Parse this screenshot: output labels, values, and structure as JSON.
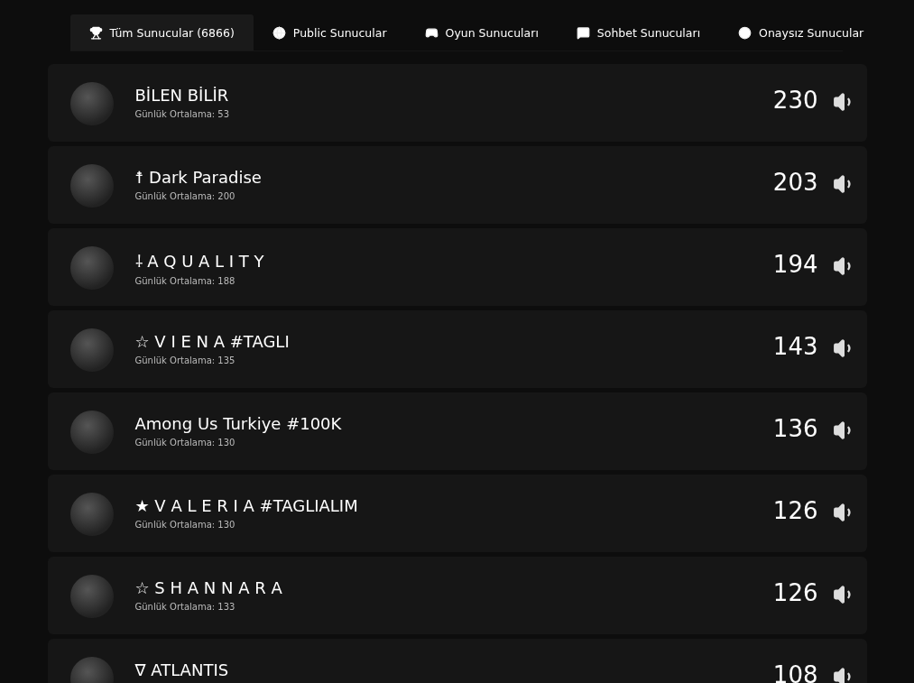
{
  "tabs": [
    {
      "label": "Tüm Sunucular (6866)",
      "selected": true
    },
    {
      "label": "Public Sunucular",
      "selected": false
    },
    {
      "label": "Oyun Sunucuları",
      "selected": false
    },
    {
      "label": "Sohbet Sunucuları",
      "selected": false
    },
    {
      "label": "Onaysız Sunucular",
      "selected": false
    }
  ],
  "servers": [
    {
      "name": "BİLEN BİLİR",
      "average": "Günlük Ortalama: 53",
      "count": "230"
    },
    {
      "name": "☨ Dark Paradise",
      "average": "Günlük Ortalama: 200",
      "count": "203"
    },
    {
      "name": "⸸ A Q U A L I T Y",
      "average": "Günlük Ortalama: 188",
      "count": "194"
    },
    {
      "name": "☆ V I E N A #TAGLI",
      "average": "Günlük Ortalama: 135",
      "count": "143"
    },
    {
      "name": "Among Us Turkiye #100K",
      "average": "Günlük Ortalama: 130",
      "count": "136"
    },
    {
      "name": "★ V A L E R I A #TAGLIALIM",
      "average": "Günlük Ortalama: 130",
      "count": "126"
    },
    {
      "name": "☆ S H A N N A R A",
      "average": "Günlük Ortalama: 133",
      "count": "126"
    },
    {
      "name": "∇ ATLANTIS",
      "count": "108"
    }
  ]
}
